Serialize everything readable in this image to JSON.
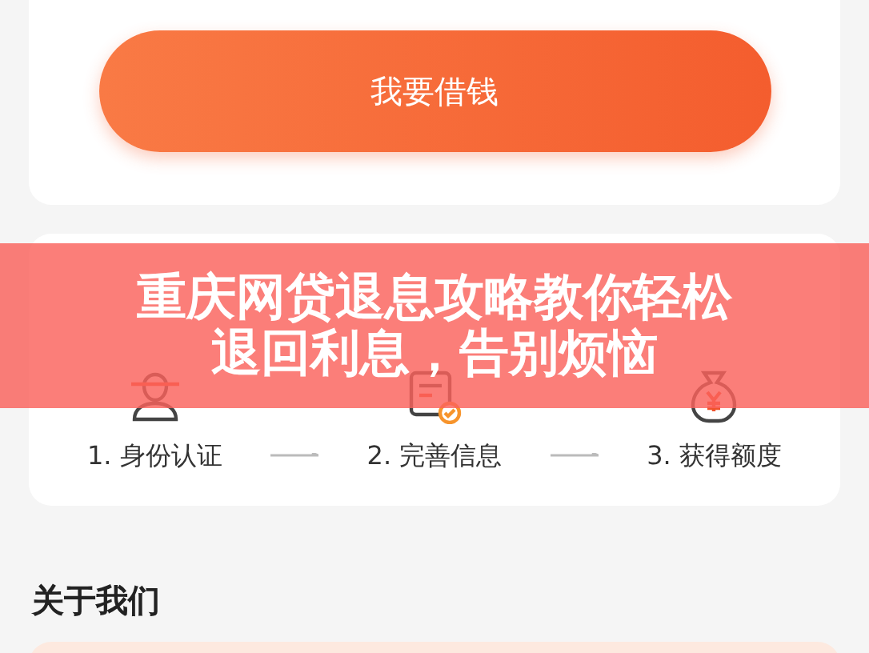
{
  "loan_button": {
    "label": "我要借钱"
  },
  "steps": [
    {
      "label": "1. 身份认证",
      "kind": "person"
    },
    {
      "label": "2. 完善信息",
      "kind": "form"
    },
    {
      "label": "3. 获得额度",
      "kind": "moneybag"
    }
  ],
  "about": {
    "title": "关于我们"
  },
  "banner": {
    "headline": "重庆网贷退息攻略教你轻松退回利息，告别烦恼"
  }
}
